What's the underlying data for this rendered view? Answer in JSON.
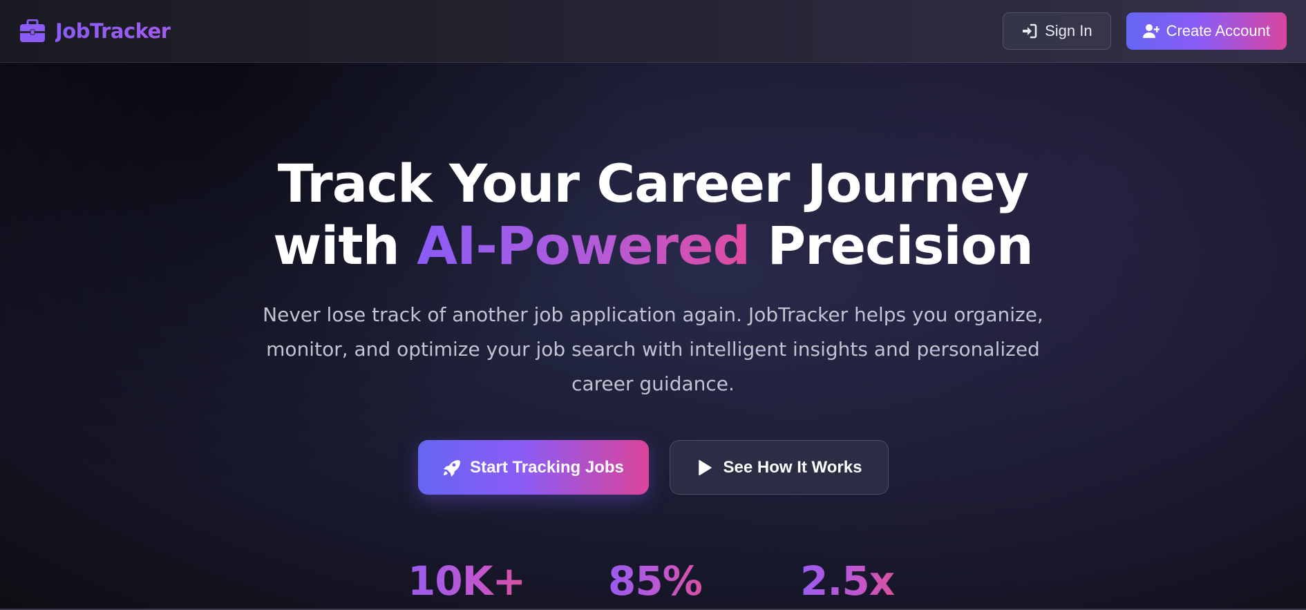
{
  "brand": {
    "name": "JobTracker",
    "icon": "briefcase-icon",
    "color": "#8b5cf6"
  },
  "nav": {
    "sign_in_label": "Sign In",
    "sign_in_icon": "sign-in-icon",
    "create_account_label": "Create Account",
    "create_account_icon": "user-plus-icon"
  },
  "hero": {
    "headline_line1": "Track Your Career Journey",
    "headline_line2_prefix": "with ",
    "headline_highlight": "AI-Powered",
    "headline_line2_suffix": " Precision",
    "subtext": "Never lose track of another job application again. JobTracker helps you organize, monitor, and optimize your job search with intelligent insights and personalized career guidance.",
    "primary_cta_label": "Start Tracking Jobs",
    "primary_cta_icon": "rocket-icon",
    "secondary_cta_label": "See How It Works",
    "secondary_cta_icon": "play-icon"
  },
  "stats": [
    {
      "value": "10K+"
    },
    {
      "value": "85%"
    },
    {
      "value": "2.5x"
    }
  ],
  "colors": {
    "accent_start": "#6466f1",
    "accent_mid": "#8b5cf6",
    "accent_end": "#db4599",
    "background": "#1e2038",
    "subtext": "#c2c4d2"
  }
}
